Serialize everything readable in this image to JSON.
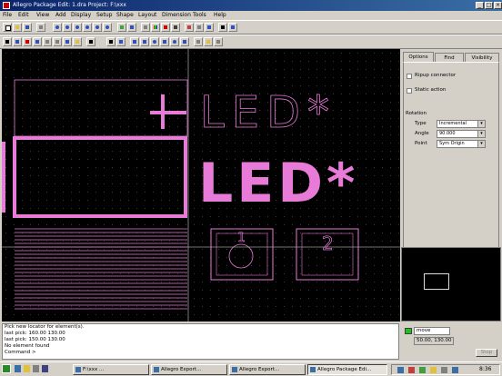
{
  "window": {
    "title": "Allegro Package Edit: 1.dra  Project: F:\\xxx"
  },
  "menu": [
    "File",
    "Edit",
    "View",
    "Add",
    "Display",
    "Setup",
    "Shape",
    "Layout",
    "Dimension",
    "Tools",
    "Help"
  ],
  "options_panel": {
    "tabs": [
      "Options",
      "Find",
      "Visibility"
    ],
    "ripup_connector": "Ripup connector",
    "static_action": "Static action",
    "rotation_heading": "Rotation",
    "type_label": "Type",
    "type_value": "Incremental",
    "angle_label": "Angle",
    "angle_value": "90.000",
    "point_label": "Point",
    "point_value": "Sym Origin"
  },
  "canvas": {
    "colors": {
      "background": "#000000",
      "shape": "#e87ad8",
      "grid": "#3c3c3c",
      "crosshair": "#b0b0b0"
    },
    "label_outline": "LED*",
    "label_filled": "LED*",
    "pin1": "1",
    "pin2": "2"
  },
  "console_lines": [
    "Pick new locator for element(s).",
    "last pick:  160.00  130.00",
    "last pick:  150.00  130.00",
    "No element found",
    "Command >"
  ],
  "status_panel": {
    "mode": "move",
    "coords": "50.00, 130.00",
    "stop": "Stop"
  },
  "taskbar": {
    "tasks": [
      "F:\\xxx ...",
      "Allegro Export...",
      "Allegro Export...",
      "Allegro Package Edi..."
    ],
    "clock": "8:36"
  }
}
